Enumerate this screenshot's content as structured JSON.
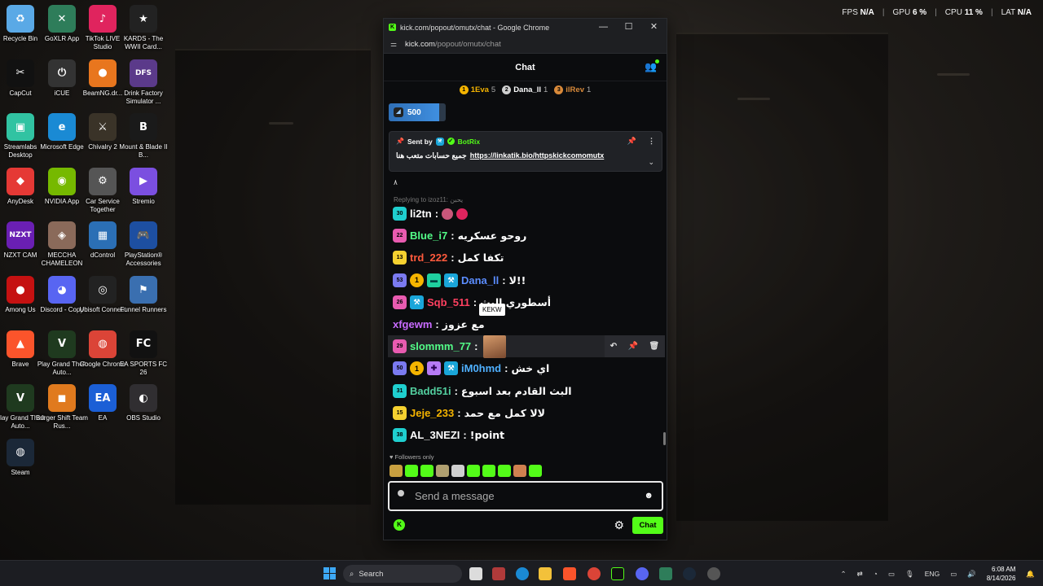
{
  "desktop": {
    "icons": [
      {
        "label": "Recycle Bin",
        "glyph": "♻",
        "color": "#5aa9e6"
      },
      {
        "label": "GoXLR App",
        "glyph": "✕",
        "color": "#2e7d5a"
      },
      {
        "label": "TikTok LIVE Studio",
        "glyph": "♪",
        "color": "#e0245e"
      },
      {
        "label": "KARDS - The WWII Card...",
        "glyph": "★",
        "color": "#222222"
      },
      {
        "label": "CapCut",
        "glyph": "✂",
        "color": "#111111"
      },
      {
        "label": "iCUE",
        "glyph": "⏻",
        "color": "#333333"
      },
      {
        "label": "BeamNG.dr...",
        "glyph": "●",
        "color": "#e8761e"
      },
      {
        "label": "Drink Factory Simulator ...",
        "glyph": "DFS",
        "color": "#5b3a8a"
      },
      {
        "label": "Streamlabs Desktop",
        "glyph": "▣",
        "color": "#31c3a2"
      },
      {
        "label": "Microsoft Edge",
        "glyph": "e",
        "color": "#1a8ad4"
      },
      {
        "label": "Chivalry 2",
        "glyph": "⚔",
        "color": "#3a3328"
      },
      {
        "label": "Mount & Blade II B...",
        "glyph": "B",
        "color": "#1a1a1a"
      },
      {
        "label": "AnyDesk",
        "glyph": "◆",
        "color": "#e53935"
      },
      {
        "label": "NVIDIA App",
        "glyph": "◉",
        "color": "#76b900"
      },
      {
        "label": "Car Service Together",
        "glyph": "⚙",
        "color": "#555555"
      },
      {
        "label": "Stremio",
        "glyph": "▶",
        "color": "#7b4fe0"
      },
      {
        "label": "NZXT CAM",
        "glyph": "NZXT",
        "color": "#6a1fb3"
      },
      {
        "label": "MECCHA CHAMELEON",
        "glyph": "◈",
        "color": "#8a6a5a"
      },
      {
        "label": "dControl",
        "glyph": "▦",
        "color": "#2b6fb5"
      },
      {
        "label": "PlayStation® Accessories",
        "glyph": "🎮",
        "color": "#1d4fa1"
      },
      {
        "label": "Among Us",
        "glyph": "●",
        "color": "#c51111"
      },
      {
        "label": "Discord - Copy",
        "glyph": "◕",
        "color": "#5865f2"
      },
      {
        "label": "Ubisoft Connect",
        "glyph": "◎",
        "color": "#222222"
      },
      {
        "label": "Funnel Runners",
        "glyph": "⚑",
        "color": "#3a6fb0"
      },
      {
        "label": "Brave",
        "glyph": "▲",
        "color": "#fb542b"
      },
      {
        "label": "Play Grand Theft Auto...",
        "glyph": "V",
        "color": "#1f3a1f"
      },
      {
        "label": "Google Chrome",
        "glyph": "◍",
        "color": "#db4437"
      },
      {
        "label": "EA SPORTS FC 26",
        "glyph": "FC",
        "color": "#111111"
      },
      {
        "label": "Play Grand Theft Auto...",
        "glyph": "V",
        "color": "#1f3a1f"
      },
      {
        "label": "Burger Shift Team Rus...",
        "glyph": "◼",
        "color": "#e07a1e"
      },
      {
        "label": "EA",
        "glyph": "EA",
        "color": "#1b5fd6"
      },
      {
        "label": "OBS Studio",
        "glyph": "◐",
        "color": "#302e31"
      },
      {
        "label": "Steam",
        "glyph": "◍",
        "color": "#1b2838"
      }
    ]
  },
  "stats": {
    "fps_label": "FPS",
    "fps_value": "N/A",
    "gpu_label": "GPU",
    "gpu_value": "6 %",
    "cpu_label": "CPU",
    "cpu_value": "11 %",
    "lat_label": "LAT",
    "lat_value": "N/A"
  },
  "window": {
    "title": "kick.com/popout/omutx/chat - Google Chrome",
    "url_host": "kick.com",
    "url_path": "/popout/omutx/chat",
    "minimize": "—",
    "maximize": "☐",
    "close": "✕"
  },
  "chat": {
    "header": "Chat",
    "leaderboard": [
      {
        "rank": "1",
        "name": "1Eva",
        "count": "5",
        "color": "#f5b400",
        "name_color": "#f5b400"
      },
      {
        "rank": "2",
        "name": "Dana_ll",
        "count": "1",
        "color": "#cfcfcf",
        "name_color": "#ffffff"
      },
      {
        "rank": "3",
        "name": "ilRev",
        "count": "1",
        "color": "#d98a3a",
        "name_color": "#d98a3a"
      }
    ],
    "goal": {
      "value": "500",
      "progress": 0.89
    },
    "pinned": {
      "sent_by": "Sent by",
      "bot": "BotRix",
      "text_ar": "جميع حسابات متعب هنا",
      "link": "https://linkatik.bio/httpskickcomomutx"
    },
    "misc_char": "٨",
    "replying_to": "Replying to izoz11: يحبن",
    "messages": [
      {
        "sub": "30",
        "sub_color": "#1fcfcf",
        "user": "li2tn",
        "color": "#ffffff",
        "text": "",
        "emotes": [
          "#c9577a",
          "#e0245e"
        ]
      },
      {
        "sub": "22",
        "sub_color": "#e85bb0",
        "user": "Blue_i7",
        "color": "#53fc88",
        "text": "روحو عسكريه"
      },
      {
        "sub": "13",
        "sub_color": "#f5d130",
        "user": "trd_222",
        "color": "#ff5a3d",
        "text": "تكفا كمل"
      },
      {
        "sub": "53",
        "sub_color": "#7a7af0",
        "badges": [
          "gold",
          "green",
          "mod"
        ],
        "user": "Dana_ll",
        "color": "#5b8dff",
        "text": "لا!!"
      },
      {
        "sub": "26",
        "sub_color": "#e85bb0",
        "badges": [
          "mod"
        ],
        "user": "Sqb_511",
        "color": "#ff4060",
        "text": "أسطوري البث"
      },
      {
        "sub": "",
        "user": "xfgewm",
        "color": "#c86bff",
        "text": "مع عزوز",
        "tooltip": "KEKW"
      },
      {
        "sub": "29",
        "sub_color": "#e85bb0",
        "user": "slommm_77",
        "color": "#53fc88",
        "text": "",
        "kekw": true,
        "highlight": true
      },
      {
        "sub": "50",
        "sub_color": "#7a7af0",
        "badges": [
          "gold",
          "purple",
          "mod"
        ],
        "user": "iM0hmd",
        "color": "#4fb0ff",
        "text": "اي خش"
      },
      {
        "sub": "31",
        "sub_color": "#1fcfcf",
        "user": "Badd51i",
        "color": "#53d0a0",
        "text": "البث القادم بعد اسبوع"
      },
      {
        "sub": "15",
        "sub_color": "#f5d130",
        "user": "Jeje_233",
        "color": "#f5b400",
        "text": "لالا كمل مع حمد"
      },
      {
        "sub": "38",
        "sub_color": "#1fcfcf",
        "user": "AL_3NEZI",
        "color": "#ffffff",
        "text": "!point"
      }
    ],
    "followers_only": "Followers only",
    "emote_colors": [
      "#c8a040",
      "#53fc18",
      "#53fc18",
      "#b0a070",
      "#cfcfcf",
      "#53fc18",
      "#53fc18",
      "#53fc18",
      "#d08050",
      "#53fc18"
    ],
    "input_placeholder": "Send a message",
    "send_label": "Chat"
  },
  "taskbar": {
    "search": "Search",
    "lang": "ENG",
    "time": "6:08 AM",
    "date": "8/14/2026"
  }
}
